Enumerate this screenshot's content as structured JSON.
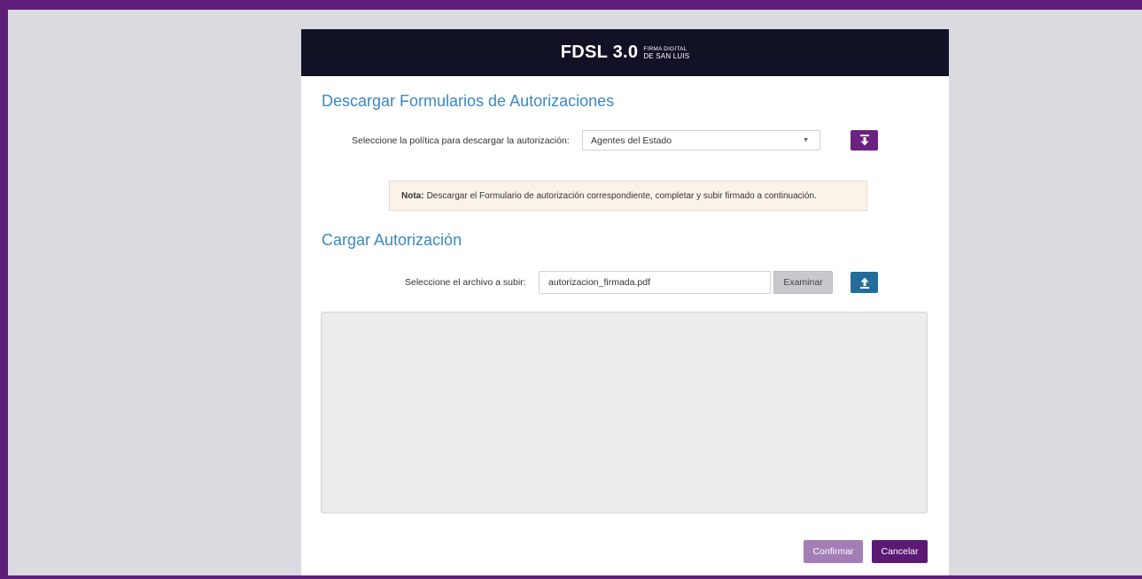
{
  "header": {
    "logo_main": "FDSL 3.0",
    "logo_sub_line1": "FIRMA DIGITAL",
    "logo_sub_line2": "DE SAN LUIS"
  },
  "download_section": {
    "title": "Descargar Formularios de Autorizaciones",
    "policy_label": "Seleccione la política para descargar la autorización:",
    "policy_selected": "Agentes del Estado",
    "download_icon": "download-icon"
  },
  "note": {
    "label": "Nota:",
    "text": "Descargar el Formulario de autorización correspondiente, completar y subir firmado a continuación."
  },
  "upload_section": {
    "title": "Cargar Autorización",
    "file_label": "Seleccione el archivo a subir:",
    "file_value": "autorizacion_firmada.pdf",
    "browse_label": "Examinar",
    "upload_icon": "upload-icon"
  },
  "actions": {
    "confirm_label": "Confirmar",
    "cancel_label": "Cancelar"
  },
  "colors": {
    "frame": "#5e1f7a",
    "header_bg": "#111226",
    "title_blue": "#3a88c3",
    "download_button": "#6b2282",
    "upload_button": "#246c9a",
    "confirm_button": "#a37eb6",
    "cancel_button": "#5c1a75"
  }
}
